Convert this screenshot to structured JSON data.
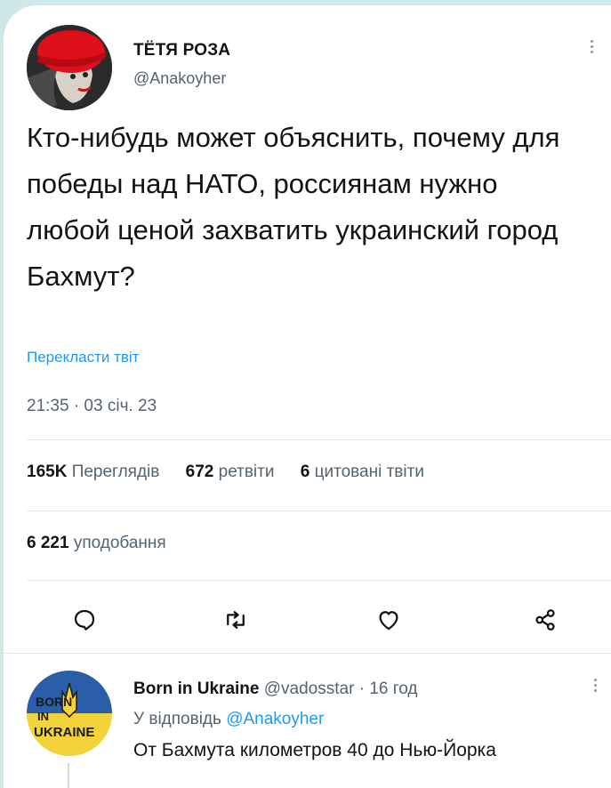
{
  "tweet": {
    "author_name": "ТЁТЯ РОЗА",
    "author_handle": "@Anakoyher",
    "text": "Кто-нибудь может объяснить, почему для победы над НАТО, россиянам нужно любой ценой захватить украинский город Бахмут?",
    "translate_label": "Перекласти твіт",
    "timestamp": "21:35 · 03 січ. 23"
  },
  "stats": {
    "views_count": "165K",
    "views_label": "Переглядів",
    "retweets_count": "672",
    "retweets_label": "ретвіти",
    "quotes_count": "6",
    "quotes_label": "цитовані твіти",
    "likes_count": "6 221",
    "likes_label": "уподобання"
  },
  "actions": {
    "reply_icon": "reply-icon",
    "retweet_icon": "retweet-icon",
    "like_icon": "heart-icon",
    "share_icon": "share-icon"
  },
  "reply": {
    "author_name": "Born in Ukraine",
    "author_handle": "@vadosstar",
    "time": "· 16 год",
    "replying_to_label": "У відповідь",
    "replying_to_handle": "@Anakoyher",
    "text": "От Бахмута километров 40 до Нью-Йорка",
    "avatar_text_top": "BORN",
    "avatar_text_mid": "IN",
    "avatar_text_bottom": "UKRAINE"
  },
  "colors": {
    "accent": "#1d9bf0",
    "secondary_text": "#536471",
    "ukraine_blue": "#2a5ea8",
    "ukraine_yellow": "#f3d23a"
  }
}
